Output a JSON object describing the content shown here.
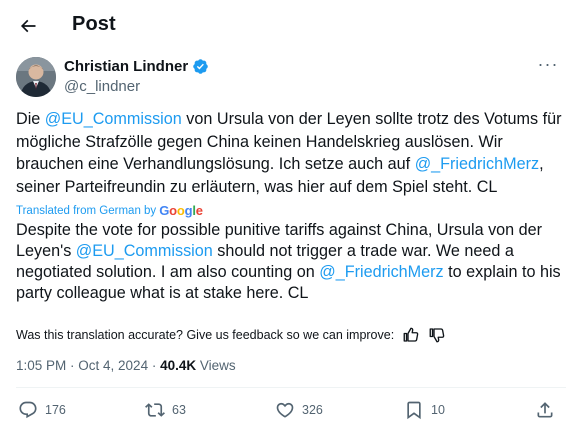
{
  "header": {
    "title": "Post",
    "back_icon": "arrow-left-icon"
  },
  "author": {
    "name": "Christian Lindner",
    "handle": "@c_lindner",
    "verified_icon": "verified-badge-icon",
    "verified_color": "#1d9bf0"
  },
  "tweet": {
    "seg1": "Die ",
    "mention_eu": "@EU_Commission",
    "seg2": " von Ursula von der Leyen sollte trotz des Votums für mögliche Strafzölle gegen China keinen Handelskrieg auslösen. Wir brauchen eine Verhandlungslösung. Ich setze auch auf ",
    "mention_merz": "@_FriedrichMerz",
    "seg3": ", seiner Parteifreundin zu erläutern, was hier auf dem Spiel steht. CL"
  },
  "translation": {
    "label": "Translated from German by",
    "provider": "Google",
    "seg1": "Despite the vote for possible punitive tariffs against China, Ursula von der Leyen's ",
    "mention_eu": "@EU_Commission",
    "seg2": " should not trigger a trade war. We need a negotiated solution. I am also counting on ",
    "mention_merz": "@_FriedrichMerz",
    "seg3": " to explain to his party colleague what is at stake here. CL",
    "feedback_prompt": "Was this translation accurate? Give us feedback so we can improve:"
  },
  "meta": {
    "time": "1:05 PM",
    "separator": " · ",
    "date": "Oct 4, 2024",
    "views_count": "40.4K",
    "views_label": " Views"
  },
  "actions": {
    "replies": "176",
    "reposts": "63",
    "likes": "326",
    "bookmarks": "10"
  },
  "colors": {
    "accent": "#1d9bf0",
    "secondary_text": "#536471",
    "text": "#0f1419"
  }
}
